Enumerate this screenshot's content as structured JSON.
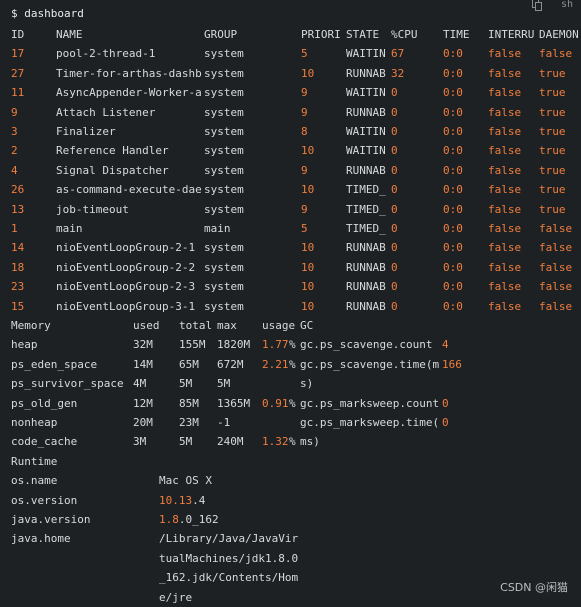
{
  "toolbar": {
    "right_text": "sh"
  },
  "prompt": "$ dashboard",
  "thread_headers": [
    "ID",
    "NAME",
    "GROUP",
    "PRIORI",
    "STATE",
    "%CPU",
    "TIME",
    "INTERRU",
    "DAEMON"
  ],
  "threads": [
    {
      "id": "17",
      "name": "pool-2-thread-1",
      "group": "system",
      "priority": "5",
      "state": "WAITIN",
      "cpu": "67",
      "time": "0:0",
      "interrupted": "false",
      "daemon": "false"
    },
    {
      "id": "27",
      "name": "Timer-for-arthas-dashb",
      "group": "system",
      "priority": "10",
      "state": "RUNNAB",
      "cpu": "32",
      "time": "0:0",
      "interrupted": "false",
      "daemon": "true"
    },
    {
      "id": "11",
      "name": "AsyncAppender-Worker-a",
      "group": "system",
      "priority": "9",
      "state": "WAITIN",
      "cpu": "0",
      "time": "0:0",
      "interrupted": "false",
      "daemon": "true"
    },
    {
      "id": "9",
      "name": "Attach Listener",
      "group": "system",
      "priority": "9",
      "state": "RUNNAB",
      "cpu": "0",
      "time": "0:0",
      "interrupted": "false",
      "daemon": "true"
    },
    {
      "id": "3",
      "name": "Finalizer",
      "group": "system",
      "priority": "8",
      "state": "WAITIN",
      "cpu": "0",
      "time": "0:0",
      "interrupted": "false",
      "daemon": "true"
    },
    {
      "id": "2",
      "name": "Reference Handler",
      "group": "system",
      "priority": "10",
      "state": "WAITIN",
      "cpu": "0",
      "time": "0:0",
      "interrupted": "false",
      "daemon": "true"
    },
    {
      "id": "4",
      "name": "Signal Dispatcher",
      "group": "system",
      "priority": "9",
      "state": "RUNNAB",
      "cpu": "0",
      "time": "0:0",
      "interrupted": "false",
      "daemon": "true"
    },
    {
      "id": "26",
      "name": "as-command-execute-dae",
      "group": "system",
      "priority": "10",
      "state": "TIMED_",
      "cpu": "0",
      "time": "0:0",
      "interrupted": "false",
      "daemon": "true"
    },
    {
      "id": "13",
      "name": "job-timeout",
      "group": "system",
      "priority": "9",
      "state": "TIMED_",
      "cpu": "0",
      "time": "0:0",
      "interrupted": "false",
      "daemon": "true"
    },
    {
      "id": "1",
      "name": "main",
      "group": "main",
      "priority": "5",
      "state": "TIMED_",
      "cpu": "0",
      "time": "0:0",
      "interrupted": "false",
      "daemon": "false"
    },
    {
      "id": "14",
      "name": "nioEventLoopGroup-2-1",
      "group": "system",
      "priority": "10",
      "state": "RUNNAB",
      "cpu": "0",
      "time": "0:0",
      "interrupted": "false",
      "daemon": "false"
    },
    {
      "id": "18",
      "name": "nioEventLoopGroup-2-2",
      "group": "system",
      "priority": "10",
      "state": "RUNNAB",
      "cpu": "0",
      "time": "0:0",
      "interrupted": "false",
      "daemon": "false"
    },
    {
      "id": "23",
      "name": "nioEventLoopGroup-2-3",
      "group": "system",
      "priority": "10",
      "state": "RUNNAB",
      "cpu": "0",
      "time": "0:0",
      "interrupted": "false",
      "daemon": "false"
    },
    {
      "id": "15",
      "name": "nioEventLoopGroup-3-1",
      "group": "system",
      "priority": "10",
      "state": "RUNNAB",
      "cpu": "0",
      "time": "0:0",
      "interrupted": "false",
      "daemon": "false"
    }
  ],
  "memory_headers": [
    "Memory",
    "used",
    "total",
    "max",
    "usage",
    "GC"
  ],
  "memory": [
    {
      "name": "heap",
      "used": "32M",
      "total": "155M",
      "max": "1820M",
      "usage_num": "1.77",
      "usage_pct": "%",
      "gc_name": "gc.ps_scavenge.count",
      "gc_value": "4"
    },
    {
      "name": "ps_eden_space",
      "used": "14M",
      "total": "65M",
      "max": "672M",
      "usage_num": "2.21",
      "usage_pct": "%",
      "gc_name": "gc.ps_scavenge.time(m",
      "gc_value": "166"
    },
    {
      "name": "ps_survivor_space",
      "used": "4M",
      "total": "5M",
      "max": "5M",
      "usage_num": "",
      "usage_pct": "",
      "gc_name": "s)",
      "gc_value": ""
    },
    {
      "name": "ps_old_gen",
      "used": "12M",
      "total": "85M",
      "max": "1365M",
      "usage_num": "0.91",
      "usage_pct": "%",
      "gc_name": "gc.ps_marksweep.count",
      "gc_value": "0"
    },
    {
      "name": "nonheap",
      "used": "20M",
      "total": "23M",
      "max": "-1",
      "usage_num": "",
      "usage_pct": "",
      "gc_name": "gc.ps_marksweep.time(",
      "gc_value": "0"
    },
    {
      "name": "code_cache",
      "used": "3M",
      "total": "5M",
      "max": "240M",
      "usage_num": "1.32",
      "usage_pct": "%",
      "gc_name": "ms)",
      "gc_value": ""
    }
  ],
  "runtime_label": "Runtime",
  "runtime": [
    {
      "key": "os.name",
      "value_lines": [
        "Mac OS X"
      ]
    },
    {
      "key": "os.version",
      "value_lines": [
        "10.13.4"
      ]
    },
    {
      "key": "java.version",
      "value_lines": [
        "1.8.0_162"
      ]
    },
    {
      "key": "java.home",
      "value_lines": [
        "/Library/Java/JavaVir",
        "tualMachines/jdk1.8.0",
        "_162.jdk/Contents/Hom",
        "e/jre"
      ]
    }
  ],
  "watermark": "CSDN @闲猫",
  "colors": {
    "accent": "#f07e3e",
    "text": "#d7dadc",
    "background": "#1e2124"
  }
}
